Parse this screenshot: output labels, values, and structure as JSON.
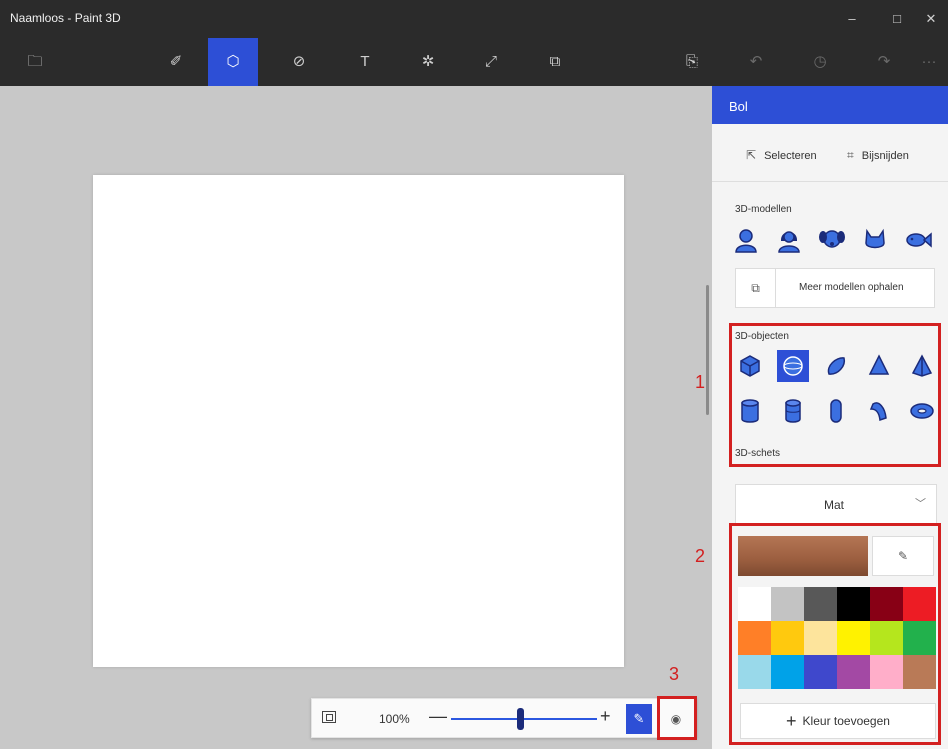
{
  "window": {
    "title": "Naamloos - Paint 3D",
    "controls": [
      "–",
      "□",
      "✕"
    ]
  },
  "toolbar": {
    "tools": [
      {
        "name": "menu-icon",
        "glyph": "🗀"
      },
      {
        "name": "brushes-icon",
        "glyph": "✐"
      },
      {
        "name": "3d-shapes-icon",
        "glyph": "⬡"
      },
      {
        "name": "2d-shapes-icon",
        "glyph": "⊘"
      },
      {
        "name": "text-icon",
        "glyph": "T"
      },
      {
        "name": "effects-icon",
        "glyph": "✲"
      },
      {
        "name": "canvas-icon",
        "glyph": "⤢"
      },
      {
        "name": "stickers-icon",
        "glyph": "⧉"
      }
    ],
    "right": [
      {
        "name": "paste-icon",
        "glyph": "⎘"
      },
      {
        "name": "undo-icon",
        "glyph": "↶"
      },
      {
        "name": "history-icon",
        "glyph": "◷"
      },
      {
        "name": "redo-icon",
        "glyph": "↷"
      },
      {
        "name": "more-icon",
        "glyph": "···"
      }
    ]
  },
  "zoom": {
    "percent": "100%",
    "level": 0.47
  },
  "panel": {
    "title": "Bol",
    "select_label": "Selecteren",
    "crop_label": "Bijsnijden",
    "models_label": "3D-modellen",
    "more_models_label": "Meer modellen ophalen",
    "objects_label": "3D-objecten",
    "sketch_label": "3D-schets",
    "finish_label": "Mat",
    "add_color_label": "Kleur toevoegen"
  },
  "colors": {
    "accent": "#2d4fd6",
    "current": "#9b5e3f",
    "annotation": "#d32020",
    "model_blue": "#3b6fe0",
    "palette": [
      "#ffffff",
      "#c3c3c3",
      "#585858",
      "#000000",
      "#880015",
      "#ed1c24",
      "#ff7f27",
      "#ffc90e",
      "#fde49c",
      "#fff200",
      "#b5e61d",
      "#22b14c",
      "#99d9ea",
      "#00a2e8",
      "#3f48cc",
      "#a349a4",
      "#ffaec9",
      "#b97a57"
    ]
  },
  "annotations": {
    "one": "1",
    "two": "2",
    "three": "3"
  }
}
